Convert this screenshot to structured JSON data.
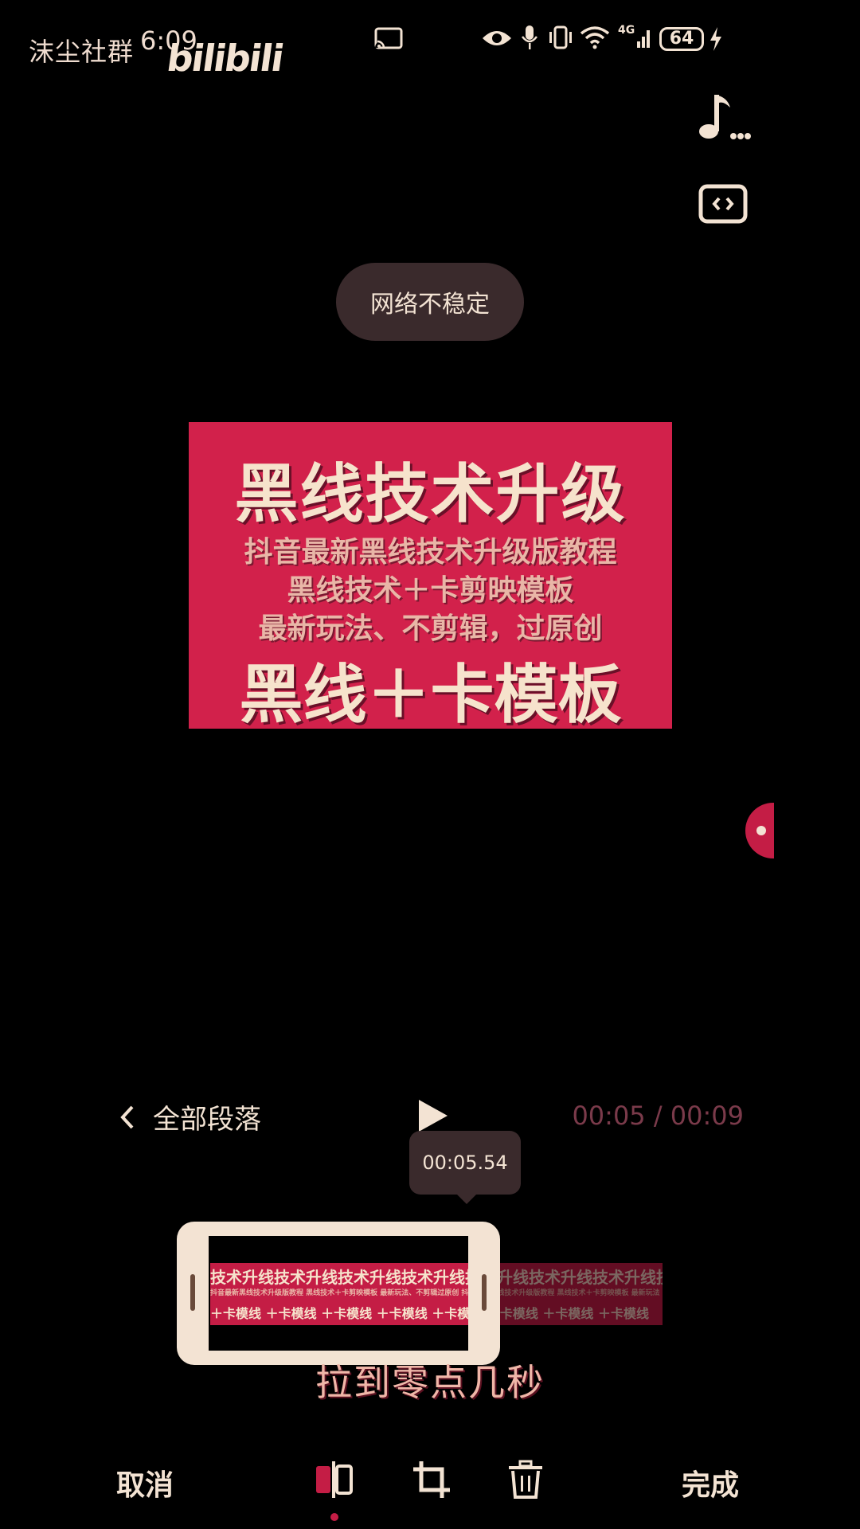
{
  "status_bar": {
    "watermark": "沫尘社群",
    "time": "6:09",
    "logo": "bilibili",
    "network": "4G",
    "battery": "64"
  },
  "toast": {
    "message": "网络不稳定"
  },
  "preview": {
    "title": "黑线技术升级",
    "lines": [
      "抖音最新黑线技术升级版教程",
      "黑线技术＋卡剪映模板",
      "最新玩法、不剪辑，过原创"
    ],
    "big": "黑线＋卡模板"
  },
  "playback": {
    "back_label": "全部段落",
    "current_time": "00:05",
    "separator": " / ",
    "total_time": "00:09",
    "playhead_time": "00:05.54"
  },
  "timeline": {
    "strip_top": "技术升线技术升线技术升线技术升线技术升线技术升线技术升线技术升线",
    "strip_mid": "抖音最新黑线技术升级版教程 黑线技术＋卡剪映模板 最新玩法、不剪辑过原创 抖音最新黑线技术升级版教程 黑线技术＋卡剪映模板 最新玩法",
    "strip_bot": "＋卡模线 ＋卡模线 ＋卡模线 ＋卡模线 ＋卡模线 ＋卡模线 ＋卡模线 ＋卡模线"
  },
  "subtitle": "拉到零点几秒",
  "bottom_bar": {
    "cancel": "取消",
    "done": "完成"
  },
  "colors": {
    "accent": "#c41d45",
    "preview_bg": "#d2214b",
    "cream": "#f3e3d3"
  }
}
